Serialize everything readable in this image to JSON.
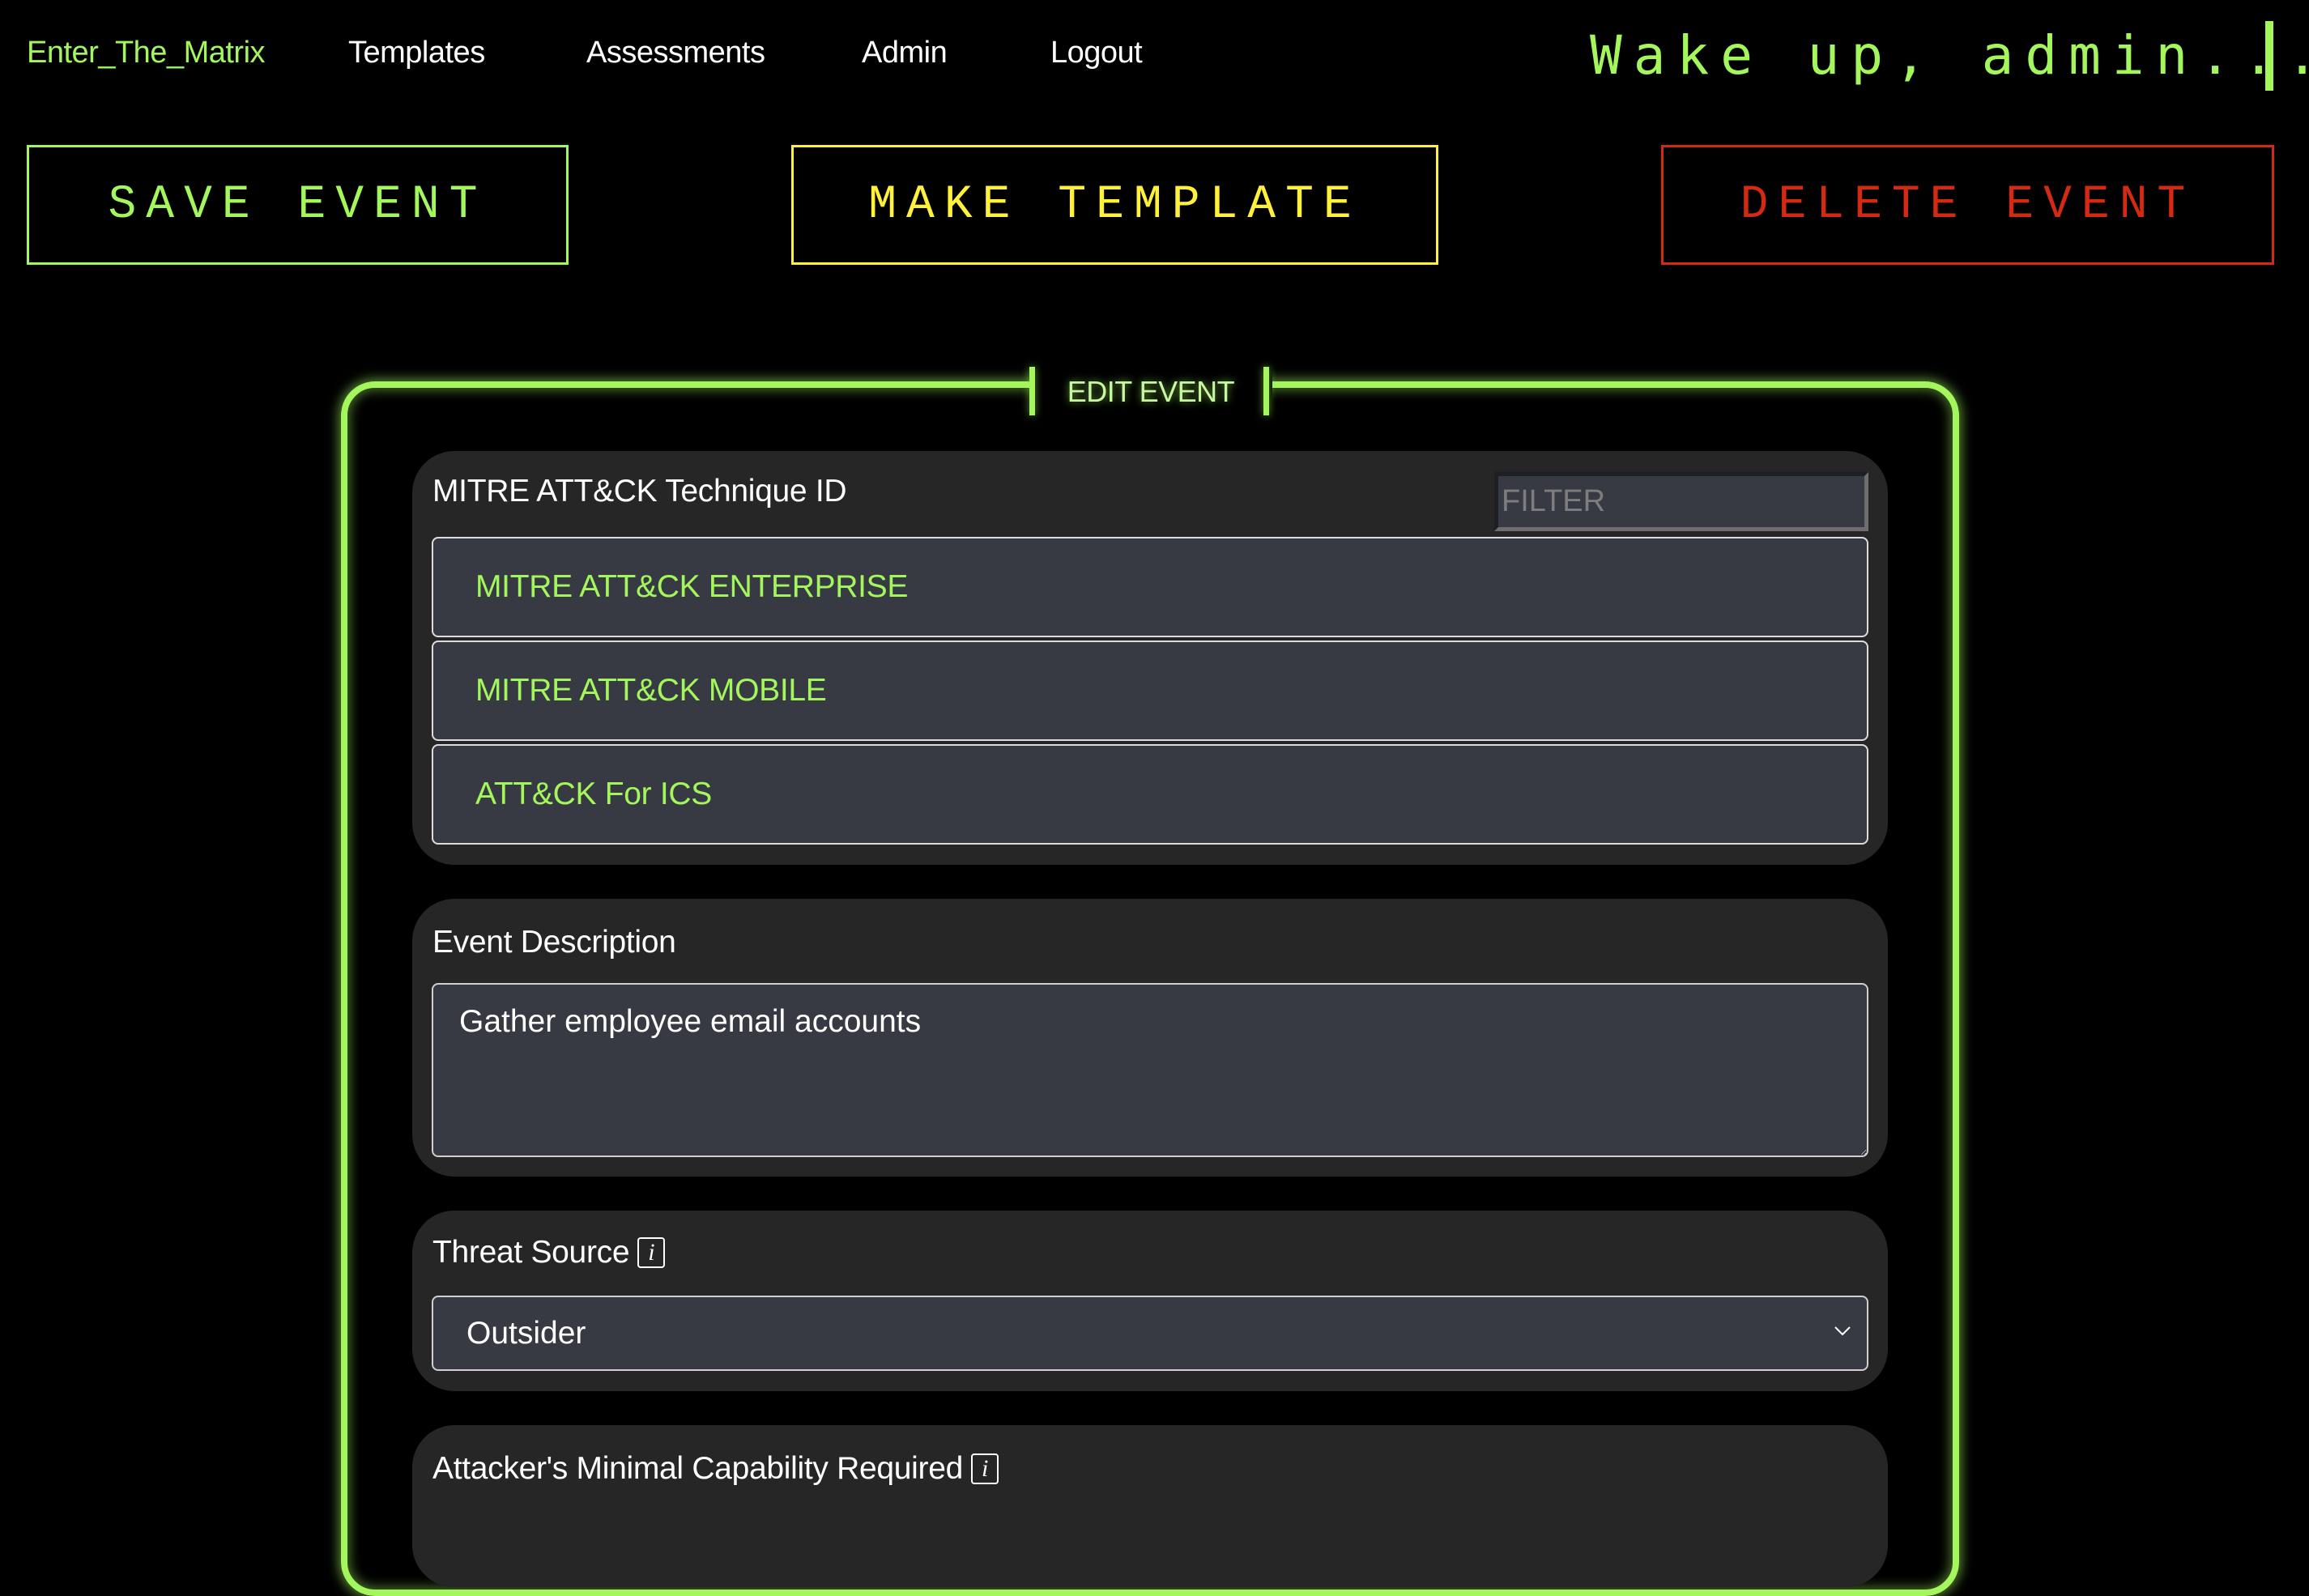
{
  "nav": {
    "brand": "Enter_The_Matrix",
    "links": [
      "Templates",
      "Assessments",
      "Admin",
      "Logout"
    ],
    "greeting": "Wake up, admin..."
  },
  "actions": {
    "save": "SAVE EVENT",
    "make_template": "MAKE TEMPLATE",
    "delete": "DELETE EVENT"
  },
  "colors": {
    "accent_green": "#a3f75c",
    "accent_yellow": "#fff03c",
    "danger_red": "#d42a12",
    "card_bg": "#262626",
    "field_bg": "#373a43"
  },
  "form": {
    "title": "EDIT EVENT",
    "technique": {
      "label": "MITRE ATT&CK Technique ID",
      "filter_placeholder": "FILTER",
      "options": [
        "MITRE ATT&CK ENTERPRISE",
        "MITRE ATT&CK MOBILE",
        "ATT&CK For ICS"
      ]
    },
    "description": {
      "label": "Event Description",
      "value": "Gather employee email accounts"
    },
    "threat_source": {
      "label": "Threat Source",
      "info_icon": "i",
      "selected": "Outsider"
    },
    "capability": {
      "label": "Attacker's Minimal Capability Required",
      "info_icon": "i"
    }
  }
}
